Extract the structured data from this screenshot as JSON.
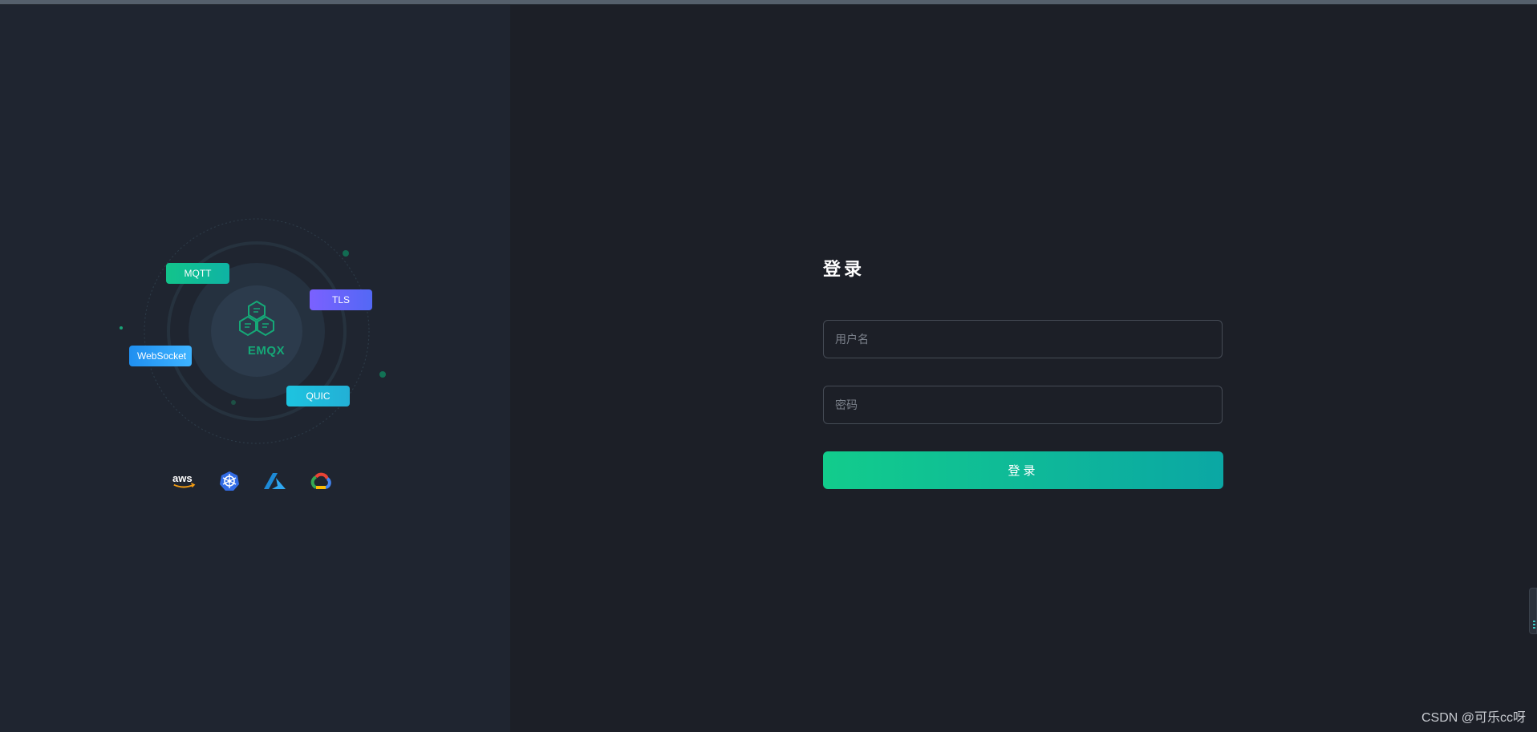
{
  "hero": {
    "protocols": {
      "mqtt": "MQTT",
      "tls": "TLS",
      "websocket": "WebSocket",
      "quic": "QUIC"
    },
    "center_label": "EMQX",
    "clouds": [
      "aws-icon",
      "kubernetes-icon",
      "azure-icon",
      "google-cloud-icon"
    ],
    "aws_text": "aws"
  },
  "login": {
    "title": "登录",
    "username_placeholder": "用户名",
    "password_placeholder": "密码",
    "submit_label": "登录"
  },
  "watermark": "CSDN @可乐cc呀",
  "colors": {
    "accent_start": "#12cc8c",
    "accent_end": "#0ba7a4",
    "background": "#1c1f27",
    "panel": "#1f2530"
  }
}
